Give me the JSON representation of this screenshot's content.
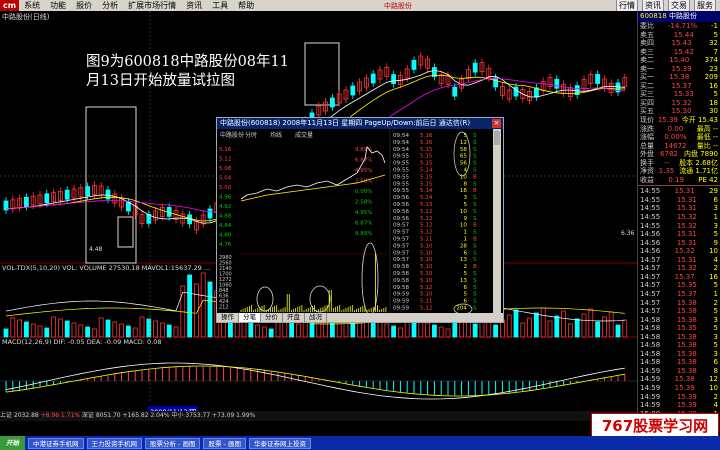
{
  "menubar": {
    "logo": "cm",
    "menus": [
      "系统",
      "功能",
      "报价",
      "分析",
      "扩展市场行情",
      "资讯",
      "工具",
      "帮助"
    ],
    "center_title": "中路股份",
    "right_buttons": [
      "行情",
      "资讯",
      "交易",
      "服务"
    ]
  },
  "chart": {
    "stock_name": "中路股份(日线)",
    "annotation_line1": "图9为600818中路股份08年11",
    "annotation_line2": "月13日开始放量试拉图",
    "price_low_label": "4.48",
    "vol_label": "VOL-TDX(5,10,20) VOL: VOLUME 27530.18 MAVOL1:15637.29 ...",
    "macd_label": "MACD(12,26,9) DIF: -0.05 DEA: -0.09 MACD: 0.08",
    "date_label": "2008/11/13/四",
    "status_line_prefix": "上证 2032.88 ",
    "status_line_up": "+8.96 1.71%",
    "status_line_rest": " 深证 8051.70 +165.82 2.04% 中小 3753.77 +73.09 1.99%",
    "right_price_label": "6.36",
    "colors": {
      "up": "#ff3333",
      "down": "#00ffff",
      "ma5": "#ffffff",
      "ma10": "#ffff00",
      "ma20": "#ff00ff"
    }
  },
  "quote": {
    "code": "600818",
    "name": "中路股份",
    "header_sub": "-14.71% 委差 -1",
    "rows": [
      {
        "k": "委比",
        "v": "-14.71%",
        "n": "-1"
      },
      {
        "k": "卖五",
        "v": "15.44",
        "n": "5"
      },
      {
        "k": "卖四",
        "v": "15.43",
        "n": "32"
      },
      {
        "k": "卖三",
        "v": "15.42",
        "n": "7"
      },
      {
        "k": "卖二",
        "v": "15.40",
        "n": "374"
      },
      {
        "k": "卖一",
        "v": "15.39",
        "n": "23"
      },
      {
        "k": "买一",
        "v": "15.38",
        "n": "209"
      },
      {
        "k": "买二",
        "v": "15.37",
        "n": "16"
      },
      {
        "k": "买三",
        "v": "15.33",
        "n": "5"
      },
      {
        "k": "买四",
        "v": "15.32",
        "n": "18"
      },
      {
        "k": "买五",
        "v": "15.30",
        "n": "30"
      },
      {
        "k": "现价",
        "v": "15.39",
        "n": "今开 15.43"
      },
      {
        "k": "涨跌",
        "v": "0.00",
        "n": "最高 --"
      },
      {
        "k": "涨幅",
        "v": "0.00%",
        "n": "最低 --"
      },
      {
        "k": "总量",
        "v": "14672",
        "n": "量比 --"
      },
      {
        "k": "外盘",
        "v": "6782",
        "n": "内盘 7890"
      },
      {
        "k": "换手",
        "v": "--",
        "n": "股本 2.68亿"
      },
      {
        "k": "净资",
        "v": "1.35",
        "n": "流通 1.71亿"
      },
      {
        "k": "收益",
        "v": "0.19",
        "n": "PE 42"
      }
    ],
    "ticks": [
      {
        "t": "14:55",
        "p": "15.31",
        "v": "29"
      },
      {
        "t": "14:55",
        "p": "15.31",
        "v": "6"
      },
      {
        "t": "14:55",
        "p": "15.31",
        "v": "3"
      },
      {
        "t": "14:55",
        "p": "15.32",
        "v": "1"
      },
      {
        "t": "14:55",
        "p": "15.32",
        "v": "3"
      },
      {
        "t": "14:56",
        "p": "15.31",
        "v": "5"
      },
      {
        "t": "14:56",
        "p": "15.31",
        "v": "9"
      },
      {
        "t": "14:56",
        "p": "15.32",
        "v": "10"
      },
      {
        "t": "14:57",
        "p": "15.31",
        "v": "4"
      },
      {
        "t": "14:57",
        "p": "15.32",
        "v": "2"
      },
      {
        "t": "14:57",
        "p": "15.37",
        "v": "16"
      },
      {
        "t": "14:57",
        "p": "15.35",
        "v": "5"
      },
      {
        "t": "14:57",
        "p": "15.37",
        "v": "1"
      },
      {
        "t": "14:57",
        "p": "15.38",
        "v": "2"
      },
      {
        "t": "14:57",
        "p": "15.38",
        "v": "5"
      },
      {
        "t": "14:58",
        "p": "15.38",
        "v": "3"
      },
      {
        "t": "14:58",
        "p": "15.35",
        "v": "5"
      },
      {
        "t": "14:58",
        "p": "15.38",
        "v": "3"
      },
      {
        "t": "14:58",
        "p": "15.38",
        "v": "5"
      },
      {
        "t": "14:58",
        "p": "15.38",
        "v": "3"
      },
      {
        "t": "14:58",
        "p": "15.38",
        "v": "6"
      },
      {
        "t": "14:59",
        "p": "15.38",
        "v": "8"
      },
      {
        "t": "14:59",
        "p": "15.38",
        "v": "12"
      },
      {
        "t": "14:59",
        "p": "15.39",
        "v": "10"
      },
      {
        "t": "14:59",
        "p": "15.39",
        "v": "2"
      },
      {
        "t": "14:59",
        "p": "15.39",
        "v": "4"
      },
      {
        "t": "15:00",
        "p": "15.39",
        "v": "1"
      }
    ]
  },
  "tickwin": {
    "title": "中路股份(600818) 2008年11月13日 星期四 PageUp/Down:前后日 通达信(R)",
    "close_label": "×",
    "header_tabs": [
      "中路股份",
      "分时",
      "均线",
      "成交量"
    ],
    "bottom_tabs": [
      "操作",
      "分笔",
      "分价",
      "开盘",
      "战况"
    ],
    "ticks": [
      {
        "t": "09:54",
        "p": "5.16",
        "v": "5",
        "d": "S"
      },
      {
        "t": "09:54",
        "p": "5.16",
        "v": "12",
        "d": "S"
      },
      {
        "t": "09:54",
        "p": "5.15",
        "v": "58",
        "d": "S"
      },
      {
        "t": "09:55",
        "p": "5.15",
        "v": "65",
        "d": "S"
      },
      {
        "t": "09:55",
        "p": "5.15",
        "v": "56",
        "d": "S"
      },
      {
        "t": "09:55",
        "p": "5.14",
        "v": "4",
        "d": "S"
      },
      {
        "t": "09:55",
        "p": "5.15",
        "v": "10",
        "d": "B"
      },
      {
        "t": "09:55",
        "p": "5.15",
        "v": "8",
        "d": "S"
      },
      {
        "t": "09:55",
        "p": "5.14",
        "v": "18",
        "d": "B"
      },
      {
        "t": "09:56",
        "p": "5.14",
        "v": "3",
        "d": "S"
      },
      {
        "t": "09:56",
        "p": "5.13",
        "v": "5",
        "d": "S"
      },
      {
        "t": "09:56",
        "p": "5.12",
        "v": "10",
        "d": "S"
      },
      {
        "t": "09:56",
        "p": "5.12",
        "v": "9",
        "d": "S"
      },
      {
        "t": "09:57",
        "p": "5.12",
        "v": "10",
        "d": "B"
      },
      {
        "t": "09:57",
        "p": "5.12",
        "v": "1",
        "d": "S"
      },
      {
        "t": "09:57",
        "p": "5.11",
        "v": "1",
        "d": "B"
      },
      {
        "t": "09:57",
        "p": "5.10",
        "v": "28",
        "d": "S"
      },
      {
        "t": "09:57",
        "p": "5.10",
        "v": "6",
        "d": "S"
      },
      {
        "t": "09:57",
        "p": "5.10",
        "v": "13",
        "d": "S"
      },
      {
        "t": "09:58",
        "p": "5.10",
        "v": "2",
        "d": "B"
      },
      {
        "t": "09:58",
        "p": "5.10",
        "v": "5",
        "d": "S"
      },
      {
        "t": "09:58",
        "p": "5.10",
        "v": "13",
        "d": "S"
      },
      {
        "t": "09:58",
        "p": "5.12",
        "v": "6",
        "d": "S"
      },
      {
        "t": "09:59",
        "p": "5.10",
        "v": "5",
        "d": "S"
      },
      {
        "t": "09:59",
        "p": "5.11",
        "v": "6",
        "d": "S"
      },
      {
        "t": "09:59",
        "p": "5.12",
        "v": "204",
        "d": "S"
      }
    ],
    "price_axis": [
      "5.16",
      "5.12",
      "5.08",
      "5.04",
      "5.00",
      "4.96",
      "4.92",
      "4.88",
      "4.84",
      "4.80",
      "4.76"
    ],
    "pct_axis": [
      "9.89%",
      "6.87%",
      "4.95%",
      "2.58%",
      "0.00%",
      "2.58%",
      "4.95%",
      "6.87%",
      "9.89%"
    ],
    "vol_axis": [
      "2980",
      "2560",
      "2140",
      "1700",
      "1272",
      "1060",
      "848",
      "636",
      "424",
      "212"
    ]
  },
  "taskbar": {
    "start": "开始",
    "tasks": [
      "中港证券手机网",
      "王力投资手机网",
      "股票分析 - 画图",
      "股票 - 画图",
      "华泰证券网上投资"
    ]
  },
  "watermark": "767股票学习网"
}
